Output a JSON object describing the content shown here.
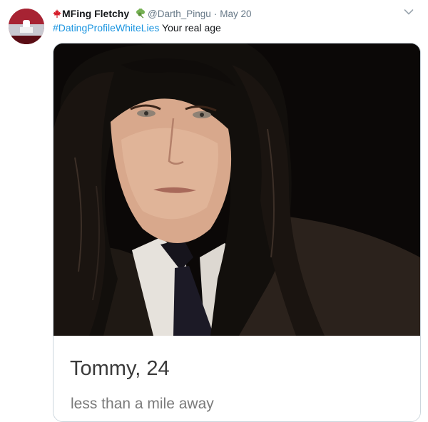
{
  "tweet": {
    "display_name": "MFing Fletchy",
    "handle": "@Darth_Pingu",
    "separator": "·",
    "date": "May 20",
    "hashtag": "#DatingProfileWhiteLies",
    "text": " Your real age",
    "icons": {
      "flag": "maple-leaf-icon",
      "emoji": "shamrock-icon",
      "menu": "chevron-down-icon"
    }
  },
  "media": {
    "profile_name": "Tommy, 24",
    "distance": "less than a mile away"
  },
  "colors": {
    "link_blue": "#1b95e0",
    "meta_gray": "#657786",
    "name_dark": "#14171a",
    "maple_red": "#d61f2b",
    "shamrock_green": "#77b255"
  }
}
